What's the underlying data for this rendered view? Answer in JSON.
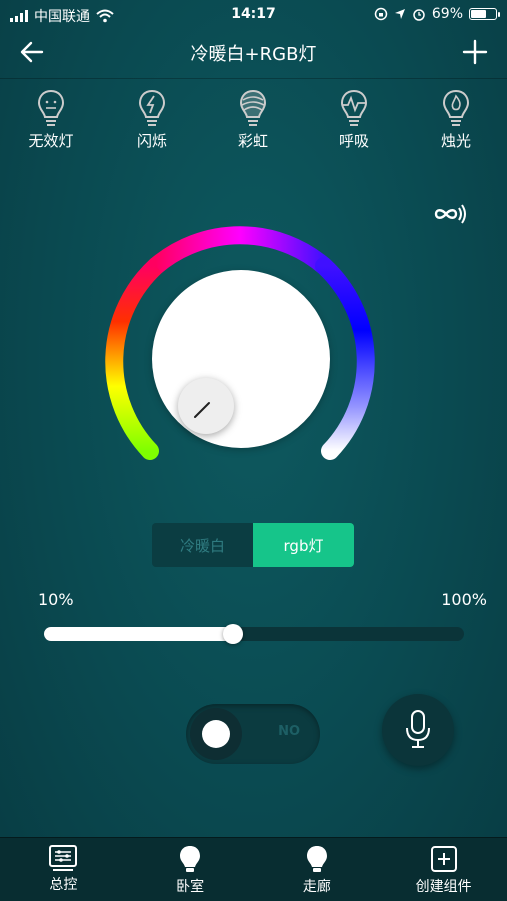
{
  "status_bar": {
    "carrier": "中国联通",
    "time": "14:17",
    "battery_percent": "69%",
    "battery_level": 0.69,
    "icons": [
      "signal-icon",
      "wifi-icon",
      "lock-rotation-icon",
      "location-icon",
      "alarm-icon",
      "battery-icon"
    ]
  },
  "nav": {
    "title": "冷暖白+RGB灯",
    "back_icon": "back-arrow-icon",
    "add_icon": "plus-icon"
  },
  "effects": [
    {
      "label": "无效灯",
      "icon": "bulb-face-icon"
    },
    {
      "label": "闪烁",
      "icon": "bulb-flash-icon"
    },
    {
      "label": "彩虹",
      "icon": "bulb-rainbow-icon"
    },
    {
      "label": "呼吸",
      "icon": "bulb-breath-icon"
    },
    {
      "label": "烛光",
      "icon": "bulb-candle-icon"
    }
  ],
  "loop_icon": "infinity-sound-icon",
  "color_wheel": {
    "gradient_colors": [
      "#ffffff",
      "#0000ff",
      "#ff00ff",
      "#ff0000",
      "#ffff00",
      "#7fff00"
    ]
  },
  "mode_toggle": {
    "options": [
      "冷暖白",
      "rgb灯"
    ],
    "selected": "rgb灯",
    "active_color": "#16c58a"
  },
  "brightness": {
    "min_label": "10%",
    "max_label": "100%",
    "value": 0.45
  },
  "power_switch": {
    "text": "NO",
    "state": "on"
  },
  "voice_button": {
    "icon": "microphone-icon"
  },
  "tabs": [
    {
      "label": "总控",
      "icon": "control-panel-icon"
    },
    {
      "label": "卧室",
      "icon": "bulb-icon"
    },
    {
      "label": "走廊",
      "icon": "bulb-icon"
    },
    {
      "label": "创建组件",
      "icon": "add-square-icon"
    }
  ]
}
